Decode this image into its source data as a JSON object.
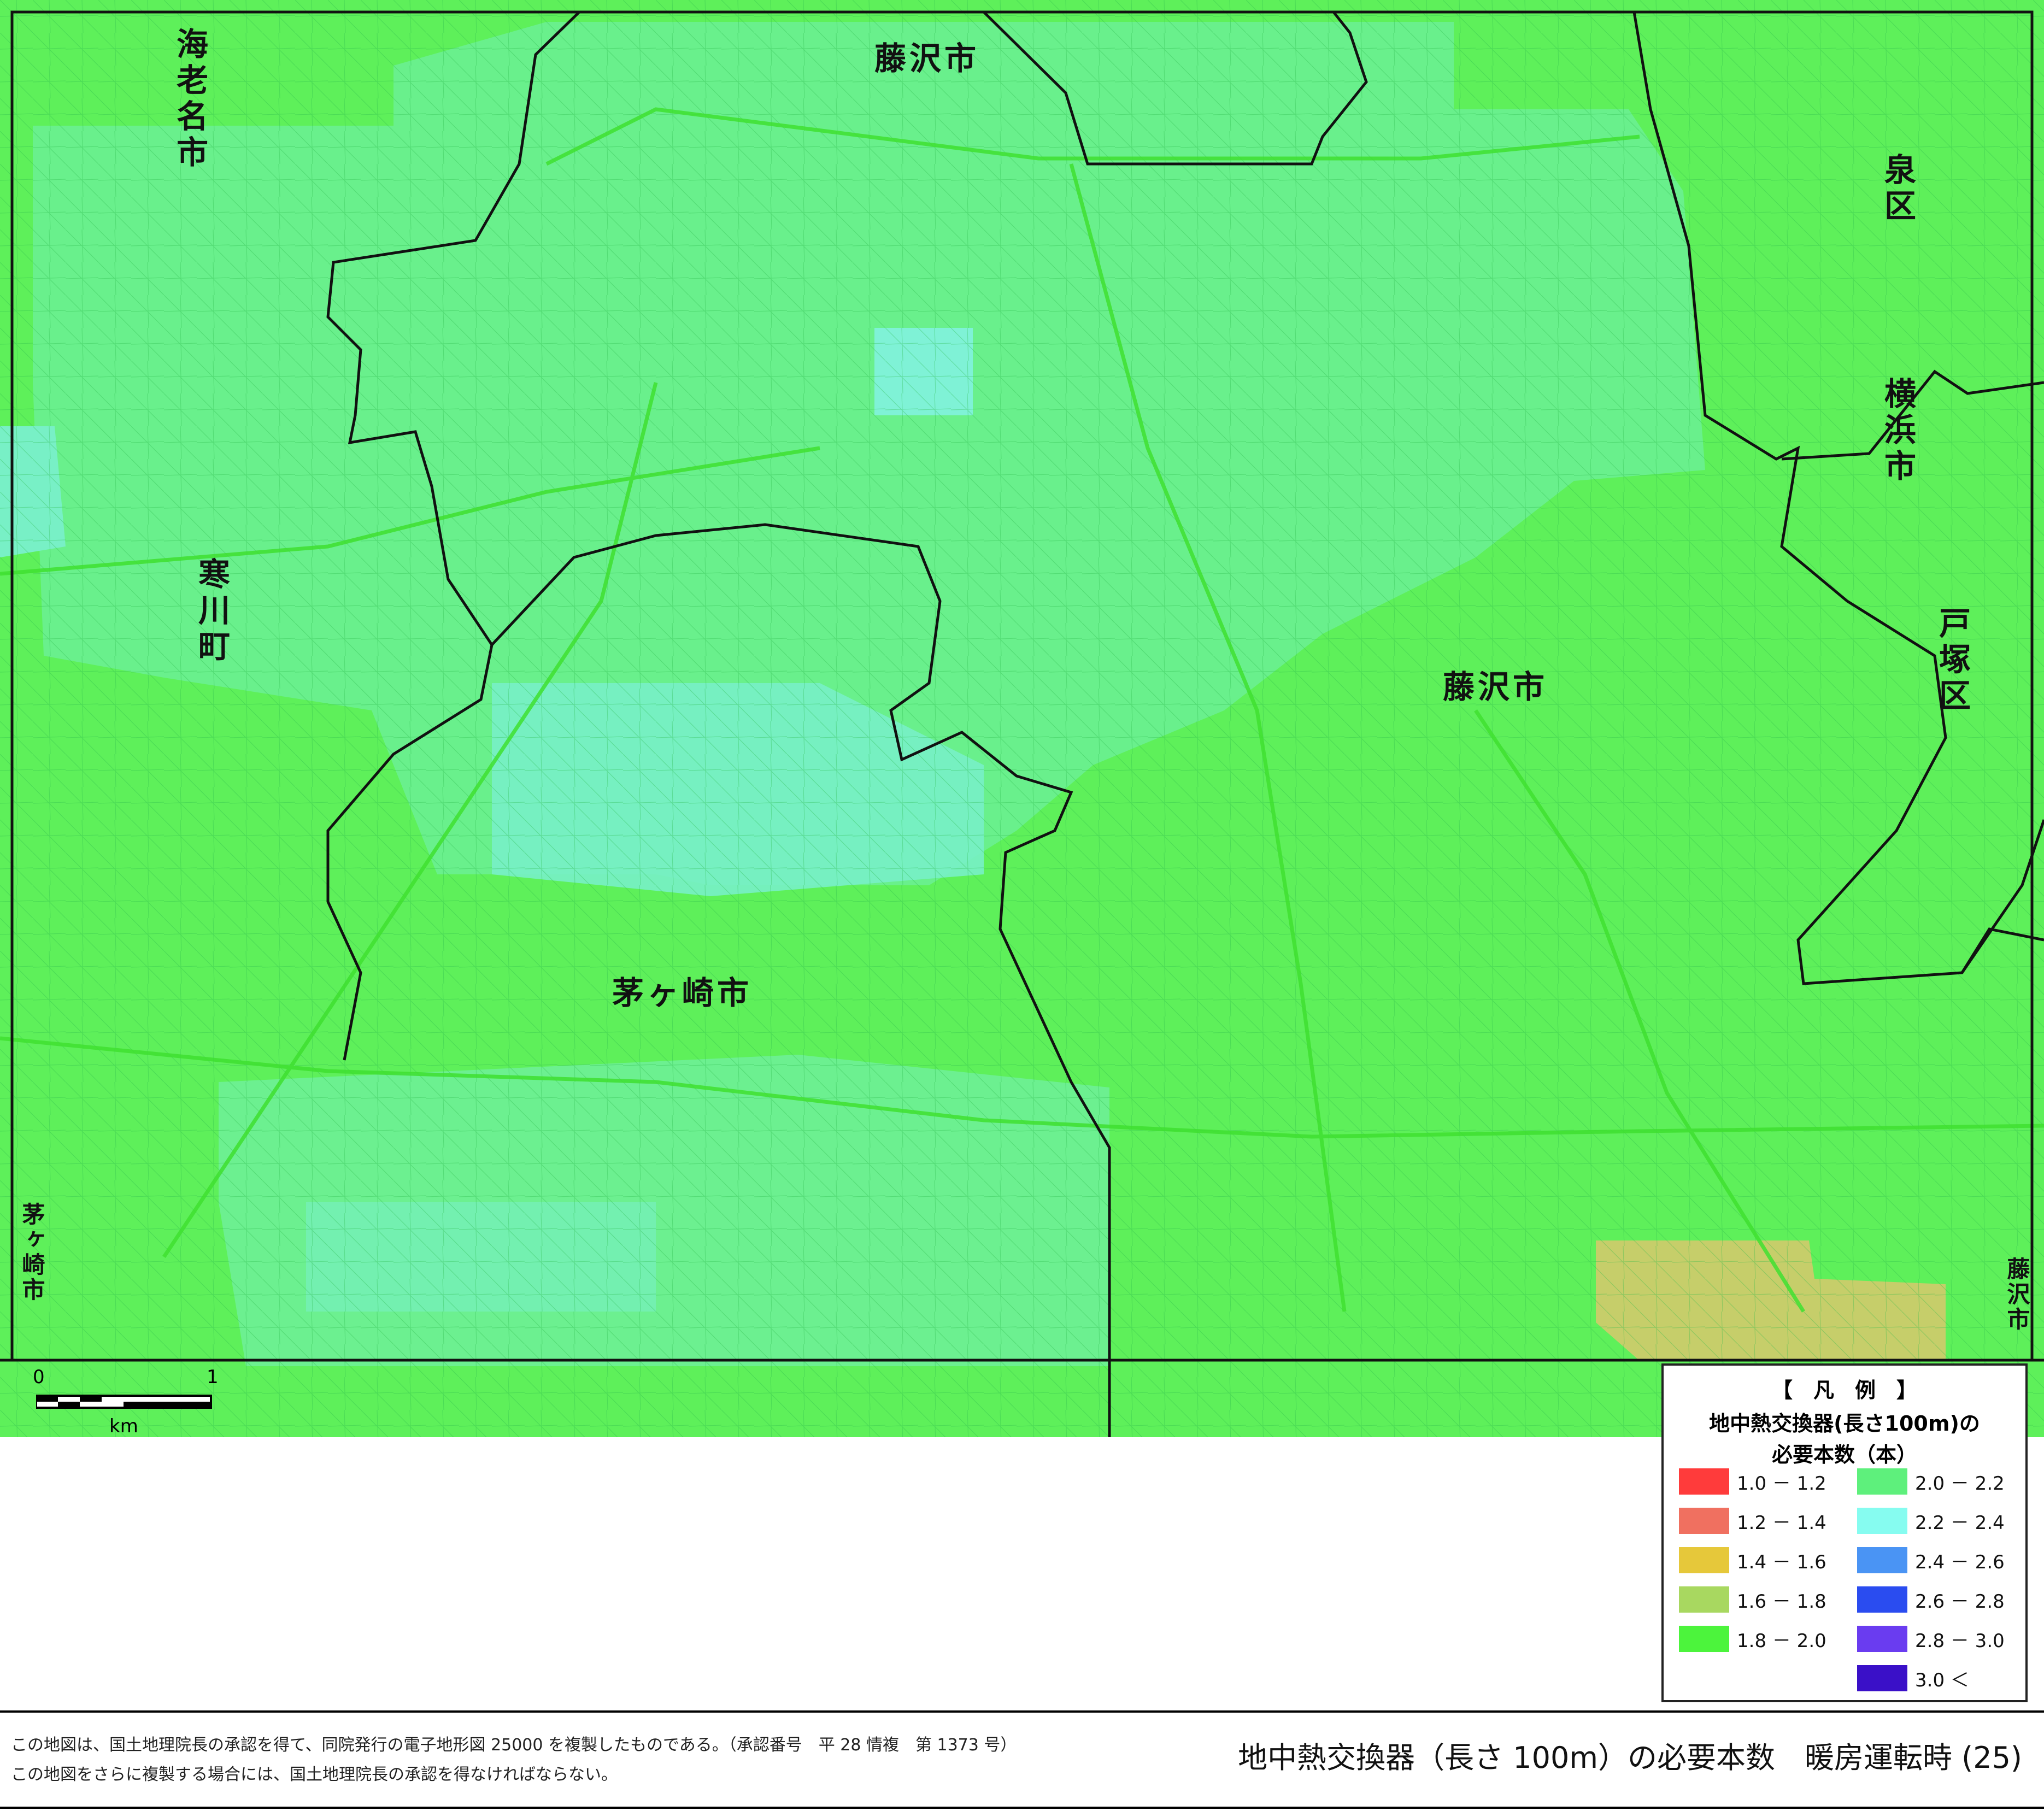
{
  "map": {
    "place_names": [
      {
        "id": "ebina",
        "text": "海老名市"
      },
      {
        "id": "fujisawa-top",
        "text": "藤沢市"
      },
      {
        "id": "izumi",
        "text": "泉区"
      },
      {
        "id": "yokohama",
        "text": "横浜市"
      },
      {
        "id": "samukawa",
        "text": "寒川町"
      },
      {
        "id": "fujisawa-mid",
        "text": "藤沢市"
      },
      {
        "id": "totsuka",
        "text": "戸塚区"
      },
      {
        "id": "chigasaki-center",
        "text": "茅ヶ崎市"
      },
      {
        "id": "chigasaki-left",
        "text": "茅ヶ崎市"
      },
      {
        "id": "fujisawa-right",
        "text": "藤沢市"
      }
    ],
    "colors": {
      "base_green": "#5ef05a",
      "light_green": "#6df08a",
      "cyan_zone": "#7bf4cc",
      "yellow_zone": "#c9cf6a",
      "boundary": "#111111"
    }
  },
  "scale_bar": {
    "label_0": "0",
    "label_1": "1",
    "unit": "km"
  },
  "legend": {
    "title_bracket": "【　凡　例　】",
    "title_line1": "地中熱交換器(長さ100m)の",
    "title_line2": "必要本数（本）",
    "items": [
      {
        "label": "1.0 － 1.2",
        "color": "#ff3b3b"
      },
      {
        "label": "1.2 － 1.4",
        "color": "#f07060"
      },
      {
        "label": "1.4 － 1.6",
        "color": "#e6c83a"
      },
      {
        "label": "1.6 － 1.8",
        "color": "#a8d860"
      },
      {
        "label": "1.8 － 2.0",
        "color": "#4cf43c"
      },
      {
        "label": "2.0 － 2.2",
        "color": "#5ef07c"
      },
      {
        "label": "2.2 － 2.4",
        "color": "#86fcf0"
      },
      {
        "label": "2.4 － 2.6",
        "color": "#4a94f4"
      },
      {
        "label": "2.6 － 2.8",
        "color": "#2a4cf0"
      },
      {
        "label": "2.8 － 3.0",
        "color": "#6a3cf0"
      },
      {
        "label": "3.0 ＜",
        "color": "#3a10c8"
      }
    ]
  },
  "footer": {
    "note1": "この地図は、国土地理院長の承認を得て、同院発行の電子地形図 25000 を複製したものである。（承認番号　平 28 情複　第 1373 号）",
    "note2": "この地図をさらに複製する場合には、国土地理院長の承認を得なければならない。",
    "title": "地中熱交換器（長さ 100m）の必要本数　暖房運転時 (25)"
  }
}
